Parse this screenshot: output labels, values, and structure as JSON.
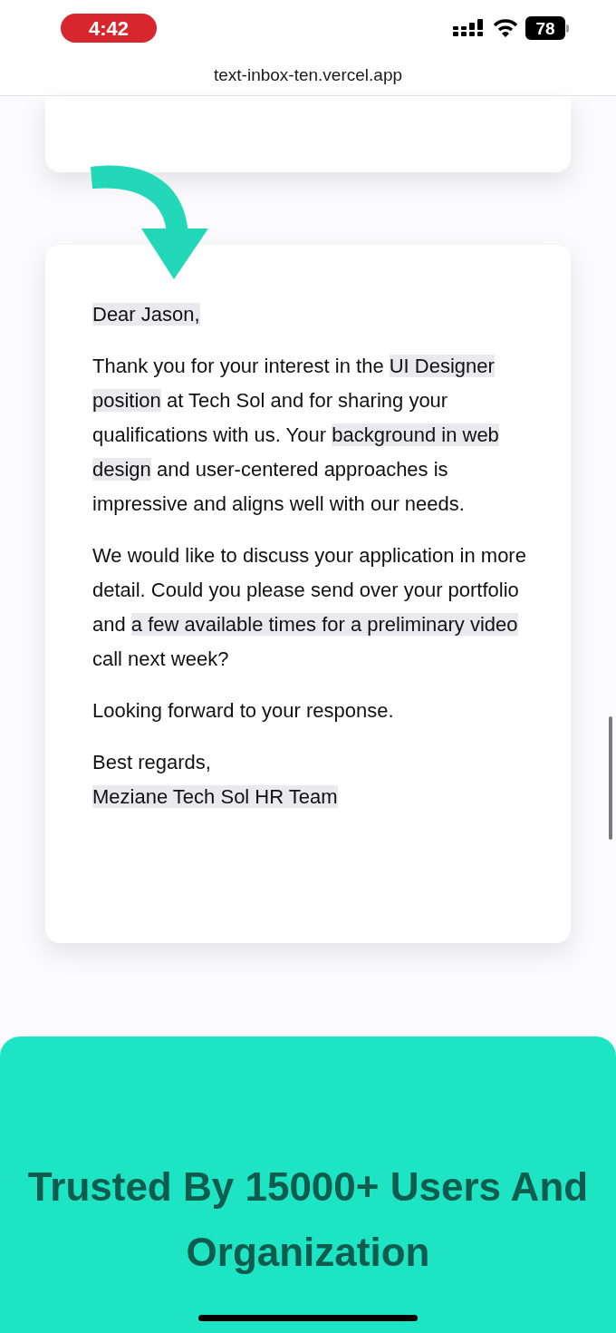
{
  "status_bar": {
    "time": "4:42",
    "battery": "78"
  },
  "address_bar": {
    "url": "text-inbox-ten.vercel.app"
  },
  "letter": {
    "paragraphs": [
      {
        "kind": "paragraph",
        "segments": [
          {
            "text": "Dear Jason,",
            "highlighted": true
          }
        ]
      },
      {
        "kind": "paragraph",
        "segments": [
          {
            "text": "Thank you for your interest in the ",
            "highlighted": false
          },
          {
            "text": "UI Designer position",
            "highlighted": true
          },
          {
            "text": " at Tech Sol and for sharing your qualifications with us. Your ",
            "highlighted": false
          },
          {
            "text": "background in web design",
            "highlighted": true
          },
          {
            "text": " and user-centered approaches is impressive and aligns well with our needs.",
            "highlighted": false
          }
        ]
      },
      {
        "kind": "paragraph",
        "segments": [
          {
            "text": "We would like to discuss your application in more detail. Could you please send over your portfolio and ",
            "highlighted": false
          },
          {
            "text": "a few available times for a preliminary video",
            "highlighted": true
          },
          {
            "text": " call next week?",
            "highlighted": false
          }
        ]
      },
      {
        "kind": "paragraph",
        "segments": [
          {
            "text": "Looking forward to your response.",
            "highlighted": false
          }
        ]
      },
      {
        "kind": "paragraph",
        "segments": [
          {
            "text": "Best regards,",
            "highlighted": false
          }
        ]
      },
      {
        "kind": "continued-line",
        "segments": [
          {
            "text": "Meziane Tech Sol HR Team",
            "highlighted": true
          }
        ]
      }
    ]
  },
  "banner": {
    "heading": "Trusted By 15000+ Users And Organization"
  }
}
